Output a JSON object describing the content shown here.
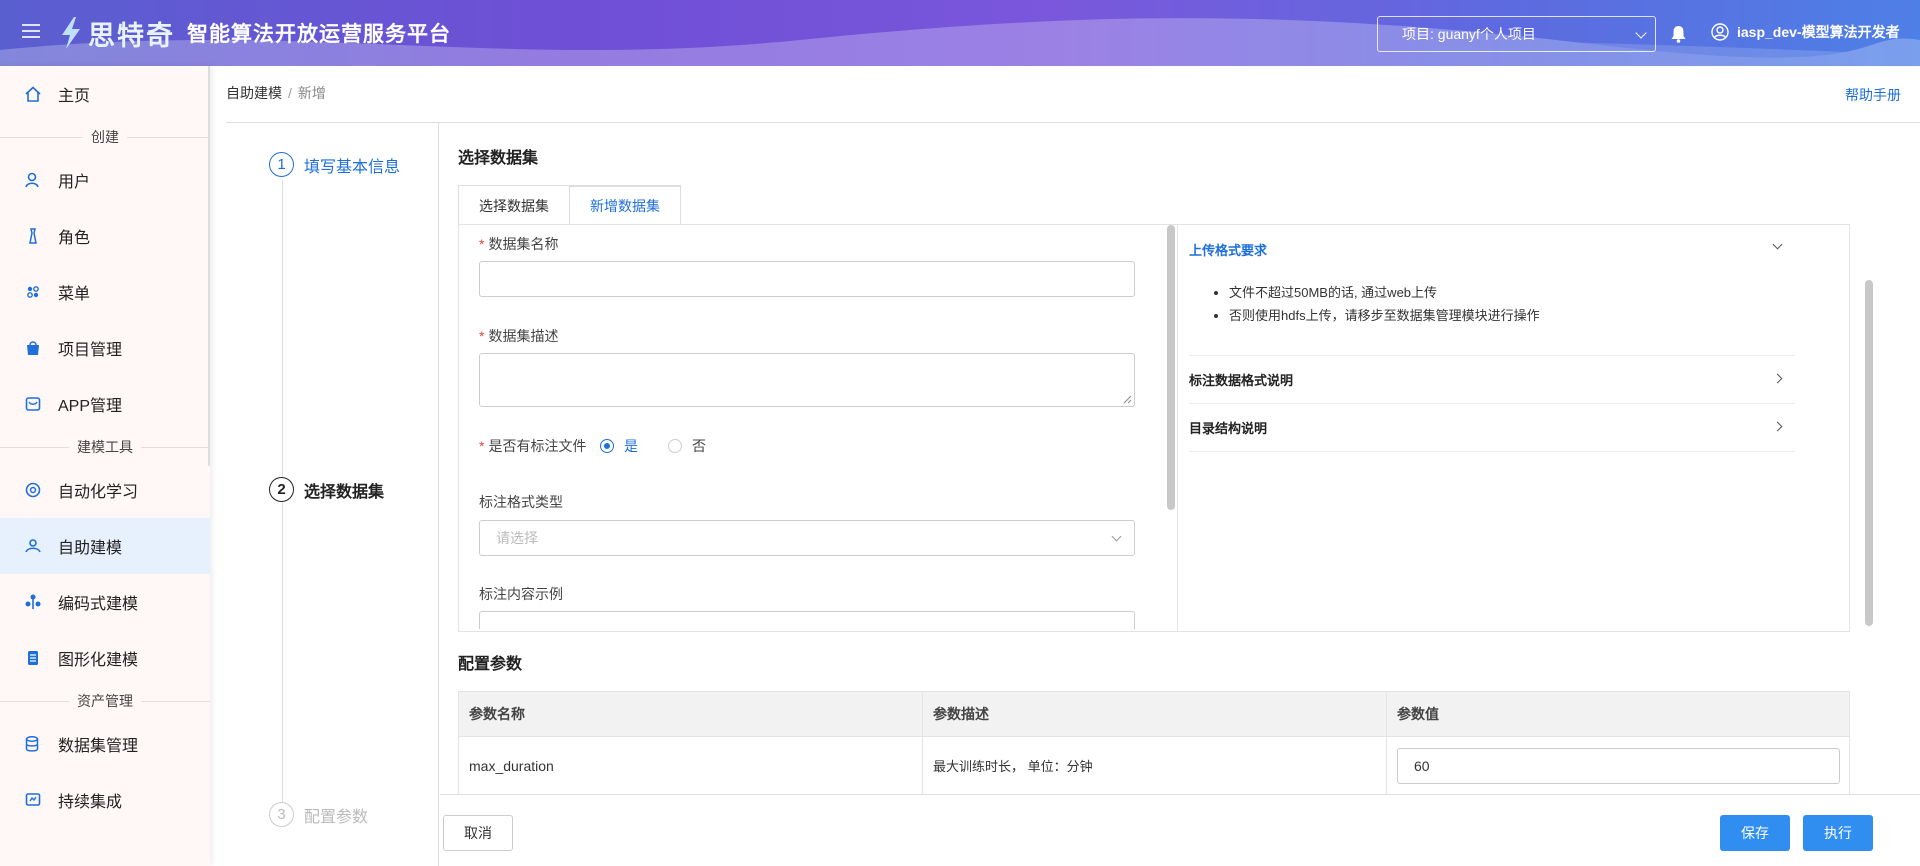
{
  "header": {
    "brand": "思特奇",
    "subtitle": "智能算法开放运营服务平台",
    "project_select": "项目: guanyf个人项目",
    "user": "iasp_dev-模型算法开发者"
  },
  "sidebar": {
    "items": [
      {
        "label": "主页",
        "icon": "home-icon"
      },
      {
        "group": "创建"
      },
      {
        "label": "用户",
        "icon": "user-icon"
      },
      {
        "label": "角色",
        "icon": "role-icon"
      },
      {
        "label": "菜单",
        "icon": "menu-grid-icon"
      },
      {
        "label": "项目管理",
        "icon": "bag-icon"
      },
      {
        "label": "APP管理",
        "icon": "app-icon"
      },
      {
        "group": "建模工具"
      },
      {
        "label": "自动化学习",
        "icon": "automl-icon"
      },
      {
        "label": "自助建模",
        "icon": "self-modeling-icon"
      },
      {
        "label": "编码式建模",
        "icon": "code-modeling-icon"
      },
      {
        "label": "图形化建模",
        "icon": "graph-modeling-icon"
      },
      {
        "group": "资产管理"
      },
      {
        "label": "数据集管理",
        "icon": "database-icon"
      },
      {
        "label": "持续集成",
        "icon": "ci-icon"
      }
    ],
    "active": "自助建模"
  },
  "breadcrumb": {
    "parent": "自助建模",
    "separator": "/",
    "current": "新增"
  },
  "help_link": "帮助手册",
  "steps": [
    {
      "num": "1",
      "label": "填写基本信息"
    },
    {
      "num": "2",
      "label": "选择数据集"
    },
    {
      "num": "3",
      "label": "配置参数"
    }
  ],
  "dataset": {
    "title": "选择数据集",
    "tabs": [
      "选择数据集",
      "新增数据集"
    ],
    "active_tab": "新增数据集",
    "fields": {
      "name_label": "数据集名称",
      "desc_label": "数据集描述",
      "has_anno_label": "是否有标注文件",
      "yes": "是",
      "no": "否",
      "selected": "是",
      "anno_type_label": "标注格式类型",
      "anno_type_placeholder": "请选择",
      "anno_example_label": "标注内容示例"
    },
    "help": {
      "upload_title": "上传格式要求",
      "upload_items": [
        "文件不超过50MB的话, 通过web上传",
        "否则使用hdfs上传，请移步至数据集管理模块进行操作"
      ],
      "anno_format_title": "标注数据格式说明",
      "dir_title": "目录结构说明"
    }
  },
  "config": {
    "title": "配置参数",
    "columns": [
      "参数名称",
      "参数描述",
      "参数值"
    ],
    "rows": [
      {
        "name": "max_duration",
        "desc": "最大训练时长， 单位：分钟",
        "value": "60"
      }
    ]
  },
  "footer": {
    "cancel": "取消",
    "save": "保存",
    "run": "执行"
  },
  "colors": {
    "primary": "#1e6fd9",
    "button": "#2f8ef0",
    "required": "#e0443f"
  }
}
